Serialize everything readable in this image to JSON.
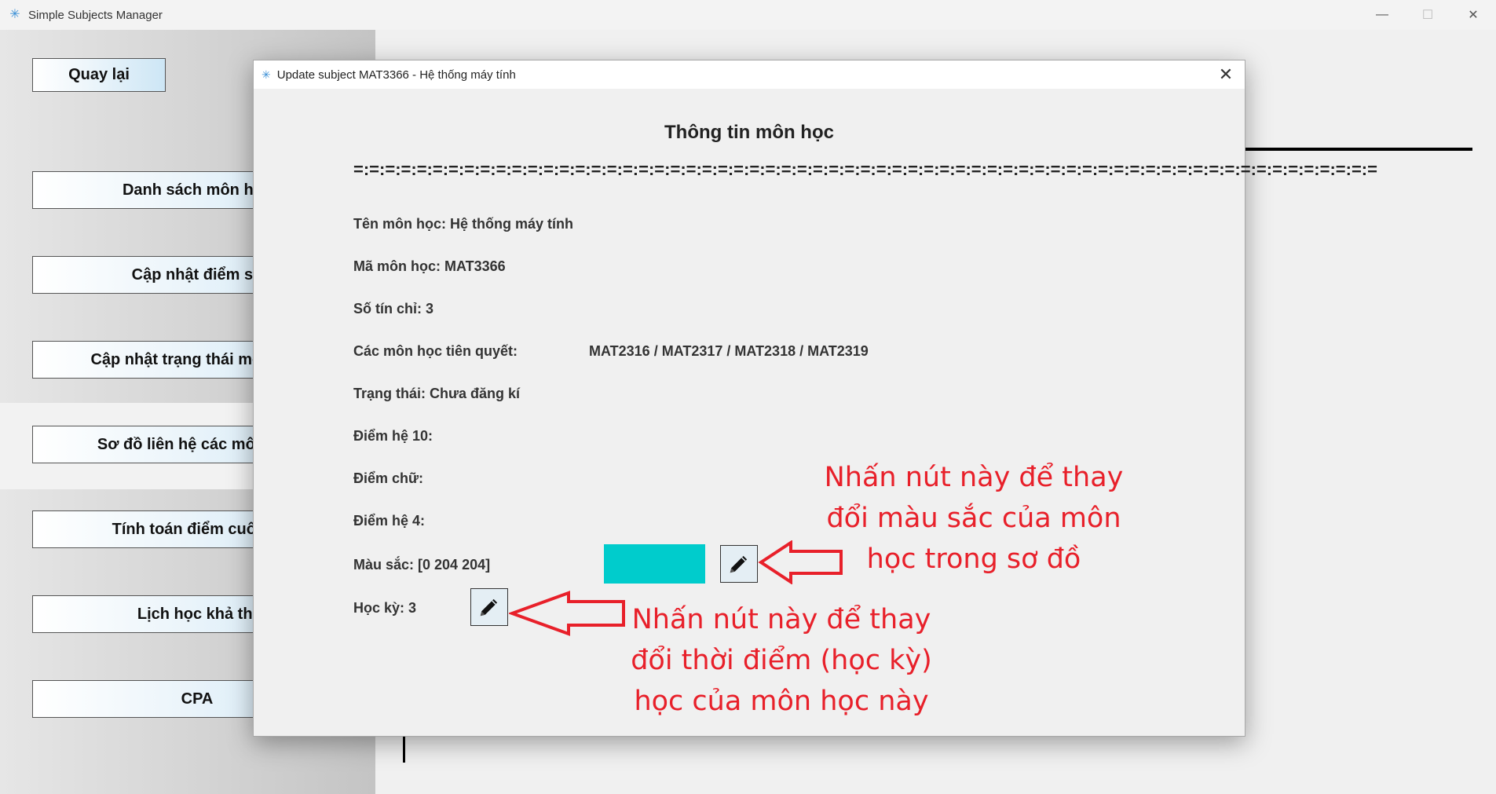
{
  "app": {
    "title": "Simple Subjects Manager",
    "minimize": "—",
    "maximize": "☐",
    "close": "✕"
  },
  "sidebar": {
    "back_label": "Quay lại",
    "items": [
      {
        "label": "Danh sách môn học"
      },
      {
        "label": "Cập nhật điểm số"
      },
      {
        "label": "Cập nhật trạng thái môn học"
      },
      {
        "label": "Sơ đồ liên hệ các môn học"
      },
      {
        "label": "Tính toán điểm cuối kỳ"
      },
      {
        "label": "Lịch học khả thi"
      },
      {
        "label": "CPA"
      }
    ]
  },
  "dialog": {
    "title": "Update subject MAT3366 - Hệ thống máy tính",
    "close": "✕",
    "heading": "Thông tin môn học",
    "separator": "=:=:=:=:=:=:=:=:=:=:=:=:=:=:=:=:=:=:=:=:=:=:=:=:=:=:=:=:=:=:=:=:=:=:=:=:=:=:=:=:=:=:=:=:=:=:=:=:=:=:=:=:=:=:=:=:=:=:=:=:=:=:=:=:=",
    "fields": {
      "name": "Tên môn học: Hệ thống máy tính",
      "code": "Mã môn học: MAT3366",
      "credits": "Số tín chỉ: 3",
      "prereq_label": "Các môn học tiên quyết:",
      "prereq_values": "MAT2316 / MAT2317 / MAT2318 / MAT2319",
      "status": "Trạng thái: Chưa đăng kí",
      "score10": "Điểm hệ 10:",
      "letter": "Điểm chữ:",
      "score4": "Điểm hệ 4:",
      "color": "Màu sắc: [0  204  204]",
      "semester": "Học kỳ: 3"
    },
    "color_value": "#00cccc",
    "edit_icon": "pencil-icon"
  },
  "annotations": {
    "color_note": [
      "Nhấn nút này để thay",
      "đổi màu sắc của môn",
      "học trong sơ đồ"
    ],
    "semester_note": [
      "Nhấn nút này để thay",
      "đổi thời điểm (học kỳ)",
      "học của môn học này"
    ],
    "color": "#e8202a"
  }
}
